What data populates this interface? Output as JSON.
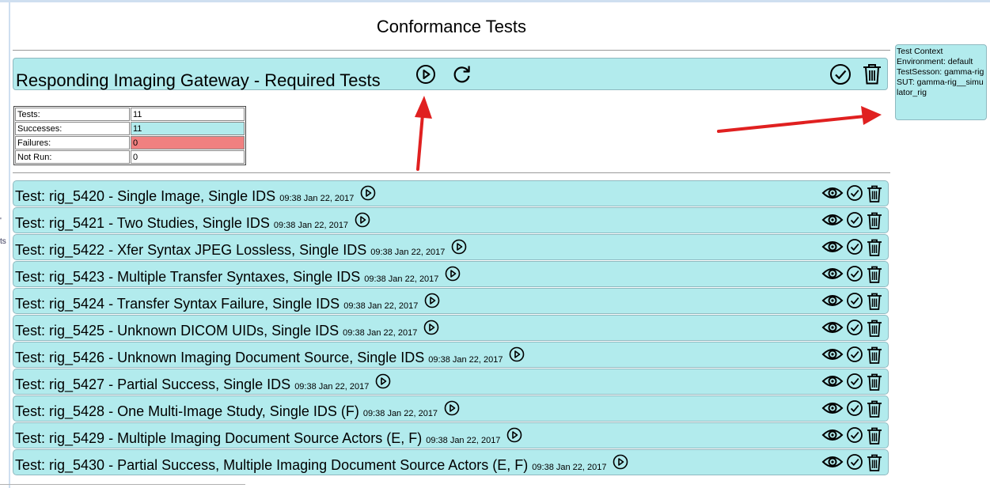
{
  "page": {
    "title": "Conformance Tests"
  },
  "header": {
    "title": "Responding Imaging Gateway - Required Tests"
  },
  "summary": [
    {
      "label": "Tests:",
      "value": "11"
    },
    {
      "label": "Successes:",
      "value": "11"
    },
    {
      "label": "Failures:",
      "value": "0"
    },
    {
      "label": "Not Run:",
      "value": "0"
    }
  ],
  "context": {
    "title": "Test Context",
    "environment": "Environment: default",
    "session": "TestSesson: gamma-rig",
    "sut": "SUT: gamma-rig__simulator_rig"
  },
  "left_fragments": [
    "'",
    "ts"
  ],
  "tests": [
    {
      "title": "Test: rig_5420 - Single Image, Single IDS",
      "time": "09:38 Jan 22, 2017"
    },
    {
      "title": "Test: rig_5421 - Two Studies, Single IDS",
      "time": "09:38 Jan 22, 2017"
    },
    {
      "title": "Test: rig_5422 - Xfer Syntax JPEG Lossless, Single IDS",
      "time": "09:38 Jan 22, 2017"
    },
    {
      "title": "Test: rig_5423 - Multiple Transfer Syntaxes, Single IDS",
      "time": "09:38 Jan 22, 2017"
    },
    {
      "title": "Test: rig_5424 - Transfer Syntax Failure, Single IDS",
      "time": "09:38 Jan 22, 2017"
    },
    {
      "title": "Test: rig_5425 - Unknown DICOM UIDs, Single IDS",
      "time": "09:38 Jan 22, 2017"
    },
    {
      "title": "Test: rig_5426 - Unknown Imaging Document Source, Single IDS",
      "time": "09:38 Jan 22, 2017"
    },
    {
      "title": "Test: rig_5427 - Partial Success, Single IDS",
      "time": "09:38 Jan 22, 2017"
    },
    {
      "title": "Test: rig_5428 - One Multi-Image Study, Single IDS (F)",
      "time": "09:38 Jan 22, 2017"
    },
    {
      "title": "Test: rig_5429 - Multiple Imaging Document Source Actors (E, F)",
      "time": "09:38 Jan 22, 2017"
    },
    {
      "title": "Test: rig_5430 - Partial Success, Multiple Imaging Document Source Actors (E, F)",
      "time": "09:38 Jan 22, 2017"
    }
  ],
  "icons": {
    "play": "play-circle-icon",
    "reload": "reload-icon",
    "check": "check-circle-icon",
    "delete": "trash-icon",
    "view": "eye-icon",
    "annotation": "red-arrow-icon"
  },
  "colors": {
    "panel": "#b2ebed",
    "failure": "#f08080",
    "arrow": "#e02020"
  }
}
